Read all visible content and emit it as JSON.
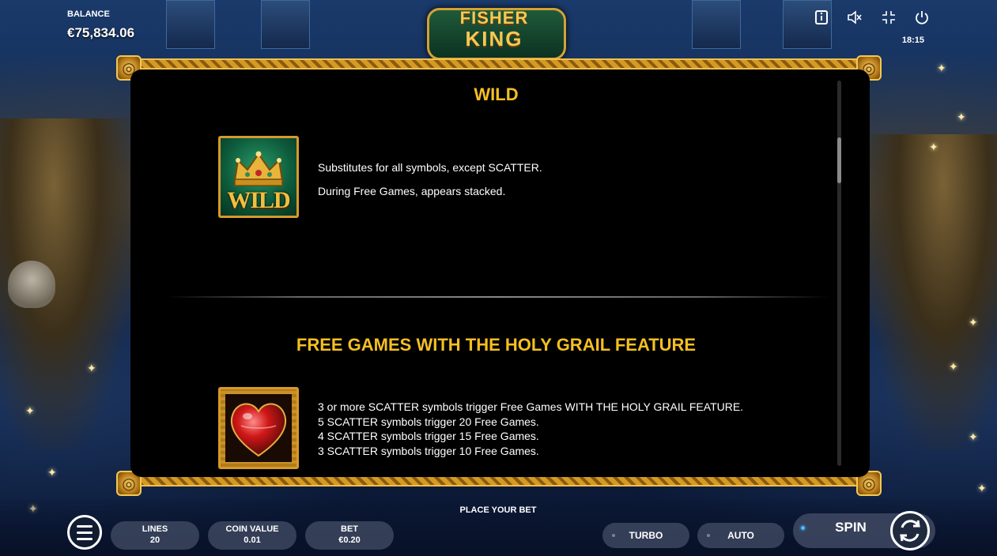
{
  "header": {
    "balance_label": "BALANCE",
    "balance_value": "€75,834.06",
    "time": "18:15",
    "logo_line1": "FISHER",
    "logo_line2": "KING",
    "icons": [
      "info-icon",
      "mute-icon",
      "fullscreen-icon",
      "power-icon"
    ]
  },
  "paytable": {
    "wild": {
      "title": "WILD",
      "symbol_text": "WILD",
      "lines": [
        "Substitutes for all symbols, except SCATTER.",
        "During Free Games, appears stacked."
      ]
    },
    "free_games": {
      "title": "FREE GAMES WITH THE HOLY GRAIL FEATURE",
      "lines": [
        "3 or more SCATTER symbols trigger Free Games WITH THE HOLY GRAIL FEATURE.",
        "5 SCATTER symbols trigger 20 Free Games.",
        "4 SCATTER symbols trigger 15 Free Games.",
        "3 SCATTER symbols trigger 10 Free Games."
      ]
    }
  },
  "controls": {
    "place_bet": "PLACE YOUR BET",
    "lines": {
      "label": "LINES",
      "value": "20"
    },
    "coin_value": {
      "label": "COIN VALUE",
      "value": "0.01"
    },
    "bet": {
      "label": "BET",
      "value": "€0.20"
    },
    "turbo": "TURBO",
    "auto": "AUTO",
    "spin": "SPIN"
  },
  "colors": {
    "heading": "#f5bf22",
    "panel_bg": "#000000",
    "frame_gold": "#d49a22",
    "spin_indicator": "#4fb8ff"
  }
}
